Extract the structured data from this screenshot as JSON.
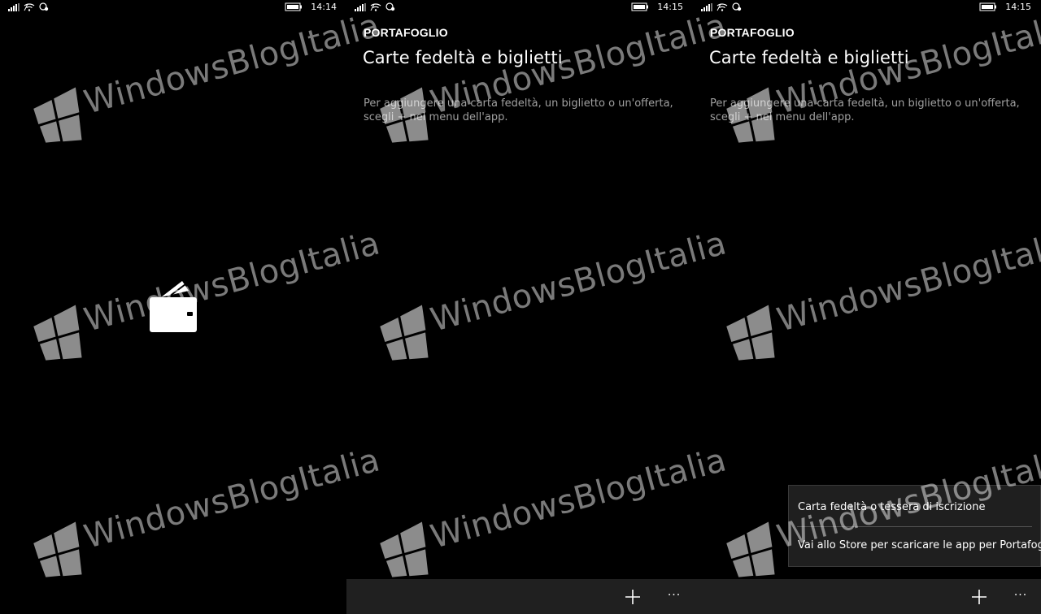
{
  "screens": [
    {
      "status": {
        "time": "14:14"
      }
    },
    {
      "status": {
        "time": "14:15"
      },
      "app_title": "PORTAFOGLIO",
      "page_title": "Carte fedeltà e biglietti",
      "hint": "Per aggiungere una carta fedeltà, un biglietto o un'offerta, scegli + nel menu dell'app.",
      "appbar": {
        "more_label": "···"
      }
    },
    {
      "status": {
        "time": "14:15"
      },
      "app_title": "PORTAFOGLIO",
      "page_title": "Carte fedeltà e biglietti",
      "hint": "Per aggiungere una carta fedeltà, un biglietto o un'offerta, scegli + nel menu dell'app.",
      "appbar": {
        "more_label": "···"
      },
      "menu": {
        "items": [
          "Carta fedeltà o tessera di iscrizione",
          "Vai allo Store per scaricare le app per Portafoglio"
        ]
      }
    }
  ],
  "watermark": "WindowsBlogItalia",
  "icons": {
    "status": [
      "signal-icon",
      "wifi-icon",
      "location-icon",
      "battery-icon"
    ],
    "splash": "wallet-icon",
    "appbar": [
      "add-icon",
      "more-icon"
    ]
  },
  "colors": {
    "background": "#000000",
    "appbar": "#202020",
    "menu": "#1f1f1f",
    "hint_text": "#a0a0a0"
  }
}
